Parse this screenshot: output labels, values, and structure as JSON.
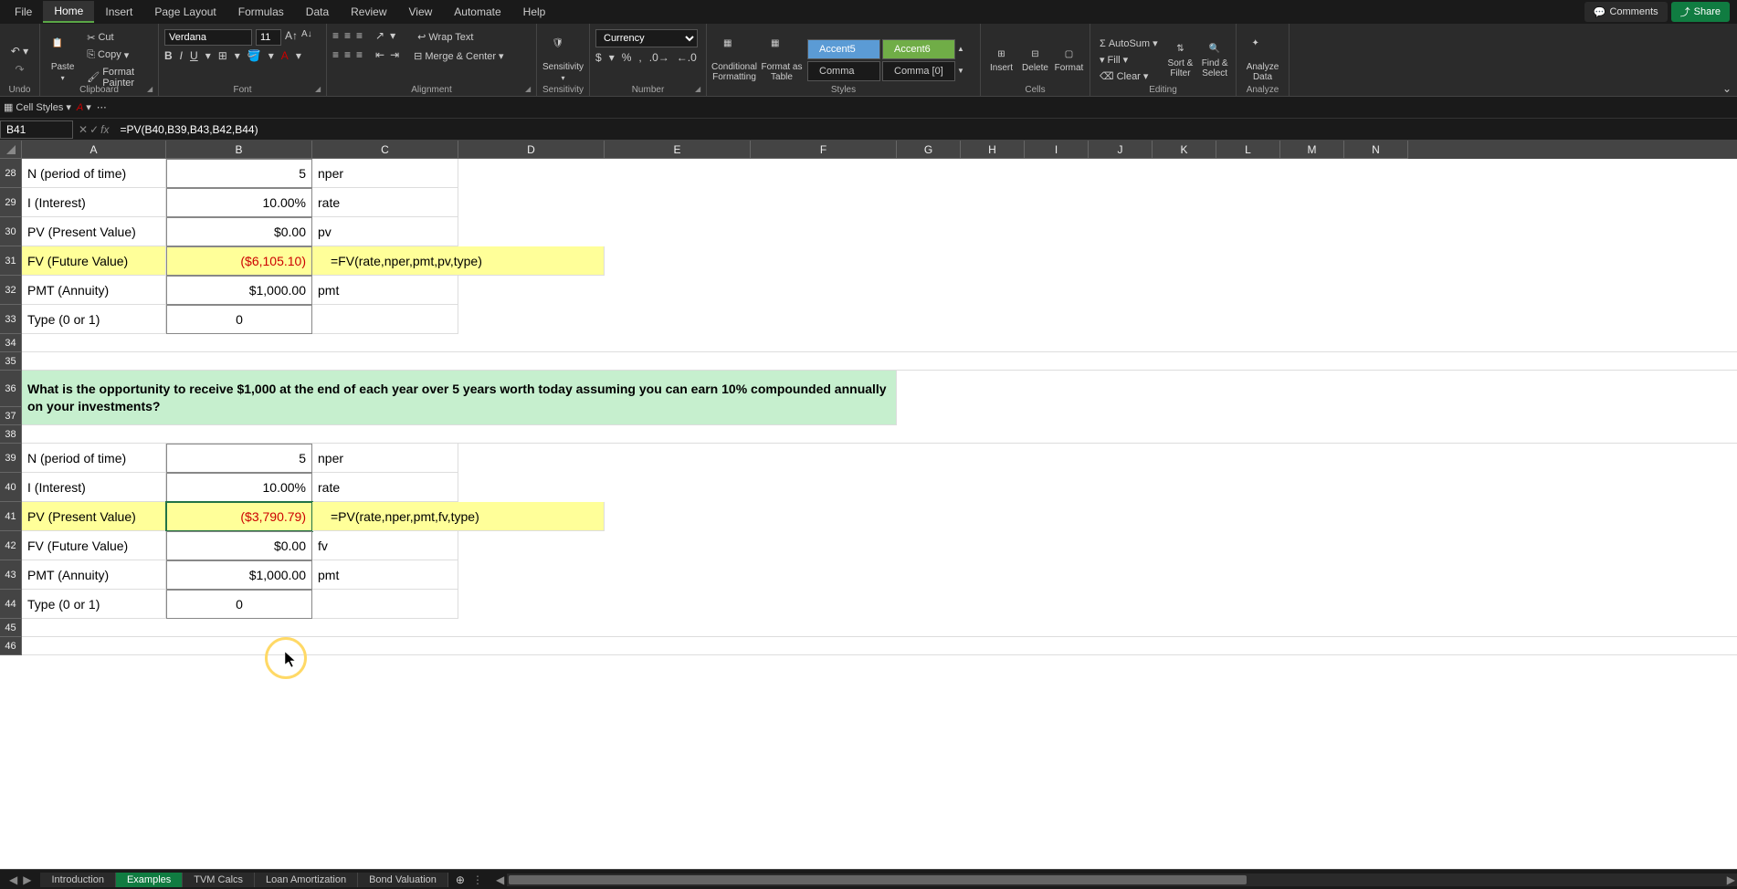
{
  "tabs": [
    "File",
    "Home",
    "Insert",
    "Page Layout",
    "Formulas",
    "Data",
    "Review",
    "View",
    "Automate",
    "Help"
  ],
  "activeTab": "Home",
  "comments": "Comments",
  "share": "Share",
  "undoGroup": "Undo",
  "clipboard": {
    "paste": "Paste",
    "cut": "Cut",
    "copy": "Copy",
    "painter": "Format Painter",
    "label": "Clipboard"
  },
  "font": {
    "name": "Verdana",
    "size": "11",
    "label": "Font"
  },
  "align": {
    "wrap": "Wrap Text",
    "merge": "Merge & Center",
    "label": "Alignment"
  },
  "sensitivity": {
    "btn": "Sensitivity",
    "label": "Sensitivity"
  },
  "number": {
    "format": "Currency",
    "label": "Number"
  },
  "styles": {
    "cond": "Conditional\nFormatting",
    "table": "Format as\nTable",
    "a5": "Accent5",
    "a6": "Accent6",
    "comma": "Comma",
    "comma0": "Comma [0]",
    "label": "Styles"
  },
  "cells": {
    "insert": "Insert",
    "delete": "Delete",
    "format": "Format",
    "label": "Cells"
  },
  "editing": {
    "sum": "AutoSum",
    "fill": "Fill",
    "clear": "Clear",
    "sort": "Sort & Filter",
    "find": "Find & Select",
    "label": "Editing"
  },
  "analyze": {
    "btn": "Analyze Data",
    "label": "Analyze"
  },
  "qa": {
    "cellStyles": "Cell Styles"
  },
  "nameBox": "B41",
  "formula": "=PV(B40,B39,B43,B42,B44)",
  "cols": [
    "A",
    "B",
    "C",
    "D",
    "E",
    "F",
    "G",
    "H",
    "I",
    "J",
    "K",
    "L",
    "M",
    "N"
  ],
  "rowNums": [
    "28",
    "29",
    "30",
    "31",
    "32",
    "33",
    "34",
    "35",
    "36",
    "37",
    "38",
    "39",
    "40",
    "41",
    "42",
    "43",
    "44",
    "45",
    "46"
  ],
  "cellsData": {
    "A28": "N (period of time)",
    "B28": "5",
    "C28": "nper",
    "A29": "I (Interest)",
    "B29": "10.00%",
    "C29": "rate",
    "A30": "PV (Present Value)",
    "B30": "$0.00",
    "C30": "pv",
    "A31": "FV (Future Value)",
    "B31": "($6,105.10)",
    "C31": "=FV(rate,nper,pmt,pv,type)",
    "A32": "PMT (Annuity)",
    "B32": "$1,000.00",
    "C32": "pmt",
    "A33": "Type (0 or 1)",
    "B33": "0",
    "A36": "What is the opportunity to receive $1,000 at the end of each year over 5 years worth today assuming you can earn 10% compounded annually on your investments?",
    "A39": "N (period of time)",
    "B39": "5",
    "C39": "nper",
    "A40": "I (Interest)",
    "B40": "10.00%",
    "C40": "rate",
    "A41": "PV (Present Value)",
    "B41": "($3,790.79)",
    "C41": "=PV(rate,nper,pmt,fv,type)",
    "A42": "FV (Future Value)",
    "B42": "$0.00",
    "C42": "fv",
    "A43": "PMT (Annuity)",
    "B43": "$1,000.00",
    "C43": "pmt",
    "A44": "Type (0 or 1)",
    "B44": "0"
  },
  "sheetTabs": [
    "Introduction",
    "Examples",
    "TVM Calcs",
    "Loan Amortization",
    "Bond Valuation"
  ],
  "activeSheet": "Examples"
}
